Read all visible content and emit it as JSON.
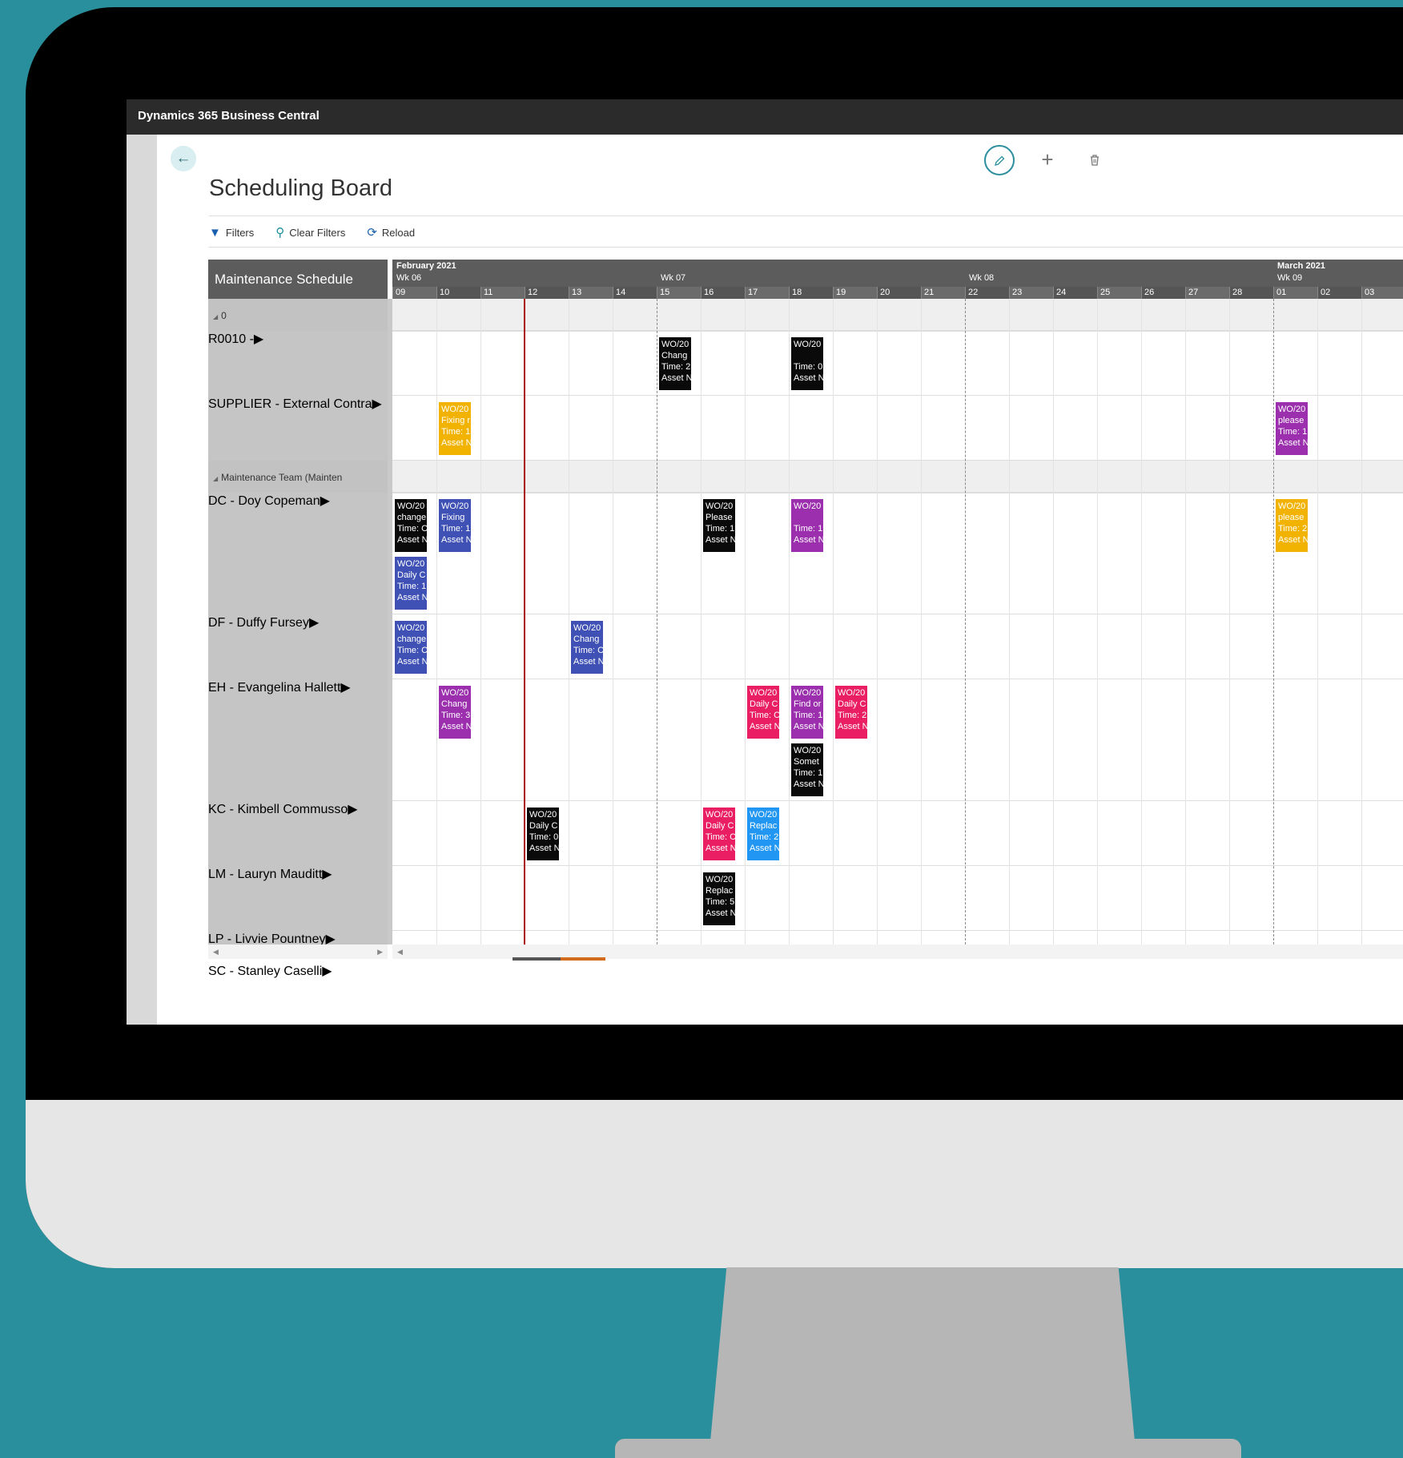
{
  "app": {
    "title": "Dynamics 365 Business Central"
  },
  "page": {
    "title": "Scheduling Board"
  },
  "toolbar": {
    "edit_icon": "pencil-icon",
    "add_icon": "plus-icon",
    "delete_icon": "trash-icon"
  },
  "actions": [
    {
      "label": "Filters",
      "icon": "filter-icon"
    },
    {
      "label": "Clear Filters",
      "icon": "clear-filter-icon"
    },
    {
      "label": "Reload",
      "icon": "refresh-icon"
    }
  ],
  "board": {
    "resource_header": "Maintenance Schedule",
    "months": [
      {
        "label": "February 2021",
        "start": 0
      },
      {
        "label": "March 2021",
        "start": 20
      }
    ],
    "weeks": [
      {
        "label": "Wk 06",
        "start": 0
      },
      {
        "label": "Wk 07",
        "start": 6
      },
      {
        "label": "Wk 08",
        "start": 13
      },
      {
        "label": "Wk 09",
        "start": 20
      }
    ],
    "days": [
      "09",
      "10",
      "11",
      "12",
      "13",
      "14",
      "15",
      "16",
      "17",
      "18",
      "19",
      "20",
      "21",
      "22",
      "23",
      "24",
      "25",
      "26",
      "27",
      "28",
      "01",
      "02",
      "03",
      "04"
    ],
    "today_index": 3,
    "colors": {
      "black": "#0a0a0a",
      "orange": "#f2b200",
      "purple": "#9b2fae",
      "blue": "#3f51b5",
      "pink": "#e91e63",
      "lightblue": "#2196f3"
    },
    "rows": [
      {
        "type": "group",
        "label": "0"
      },
      {
        "type": "resource",
        "label": "R0010 -"
      },
      {
        "type": "resource",
        "label": "SUPPLIER - External Contra"
      },
      {
        "type": "group",
        "label": "Maintenance Team (Mainten"
      },
      {
        "type": "resource",
        "label": "DC - Doy Copeman"
      },
      {
        "type": "resource",
        "label": "DF - Duffy Fursey"
      },
      {
        "type": "resource",
        "label": "EH - Evangelina Hallett"
      },
      {
        "type": "resource",
        "label": "KC - Kimbell Commusso"
      },
      {
        "type": "resource",
        "label": "LM - Lauryn Mauditt"
      },
      {
        "type": "resource",
        "label": "LP - Livvie Pountney"
      },
      {
        "type": "resource",
        "label": "SC - Stanley Caselli"
      }
    ],
    "work_orders": [
      {
        "row": 1,
        "day": 6,
        "slot": 0,
        "color": "black",
        "lines": [
          "WO/20",
          "Chang",
          "Time: 2",
          "Asset N"
        ]
      },
      {
        "row": 1,
        "day": 9,
        "slot": 0,
        "color": "black",
        "lines": [
          "WO/20",
          "",
          "Time: 0",
          "Asset N"
        ]
      },
      {
        "row": 2,
        "day": 1,
        "slot": 0,
        "color": "orange",
        "lines": [
          "WO/20",
          "Fixing r",
          "Time: 1",
          "Asset N"
        ]
      },
      {
        "row": 2,
        "day": 20,
        "slot": 0,
        "color": "purple",
        "lines": [
          "WO/20",
          "please",
          "Time: 1",
          "Asset N"
        ]
      },
      {
        "row": 4,
        "day": 0,
        "slot": 0,
        "color": "black",
        "lines": [
          "WO/20",
          "change",
          "Time: C",
          "Asset N"
        ]
      },
      {
        "row": 4,
        "day": 0,
        "slot": 1,
        "color": "blue",
        "lines": [
          "WO/20",
          "Daily C",
          "Time: 1",
          "Asset N"
        ]
      },
      {
        "row": 4,
        "day": 1,
        "slot": 0,
        "color": "blue",
        "lines": [
          "WO/20",
          "Fixing",
          "Time: 1",
          "Asset N"
        ]
      },
      {
        "row": 4,
        "day": 7,
        "slot": 0,
        "color": "black",
        "lines": [
          "WO/20",
          "Please",
          "Time: 1",
          "Asset N"
        ]
      },
      {
        "row": 4,
        "day": 9,
        "slot": 0,
        "color": "purple",
        "lines": [
          "WO/20",
          "",
          "Time: 1",
          "Asset N"
        ]
      },
      {
        "row": 4,
        "day": 20,
        "slot": 0,
        "color": "orange",
        "lines": [
          "WO/20",
          "please",
          "Time: 2",
          "Asset N"
        ]
      },
      {
        "row": 5,
        "day": 0,
        "slot": 0,
        "color": "blue",
        "lines": [
          "WO/20",
          "change",
          "Time: C",
          "Asset N"
        ]
      },
      {
        "row": 5,
        "day": 4,
        "slot": 0,
        "color": "blue",
        "lines": [
          "WO/20",
          "Chang",
          "Time: C",
          "Asset N"
        ]
      },
      {
        "row": 6,
        "day": 1,
        "slot": 0,
        "color": "purple",
        "lines": [
          "WO/20",
          "Chang",
          "Time: 3",
          "Asset N"
        ]
      },
      {
        "row": 6,
        "day": 8,
        "slot": 0,
        "color": "pink",
        "lines": [
          "WO/20",
          "Daily C",
          "Time: C",
          "Asset N"
        ]
      },
      {
        "row": 6,
        "day": 9,
        "slot": 0,
        "color": "purple",
        "lines": [
          "WO/20",
          "Find or",
          "Time: 1",
          "Asset N"
        ]
      },
      {
        "row": 6,
        "day": 9,
        "slot": 1,
        "color": "black",
        "lines": [
          "WO/20",
          "Somet",
          "Time: 1",
          "Asset N"
        ]
      },
      {
        "row": 6,
        "day": 10,
        "slot": 0,
        "color": "pink",
        "lines": [
          "WO/20",
          "Daily C",
          "Time: 2",
          "Asset N"
        ]
      },
      {
        "row": 7,
        "day": 3,
        "slot": 0,
        "color": "black",
        "lines": [
          "WO/20",
          "Daily C",
          "Time: 0",
          "Asset N"
        ]
      },
      {
        "row": 7,
        "day": 7,
        "slot": 0,
        "color": "pink",
        "lines": [
          "WO/20",
          "Daily C",
          "Time: C",
          "Asset N"
        ]
      },
      {
        "row": 7,
        "day": 8,
        "slot": 0,
        "color": "lightblue",
        "lines": [
          "WO/20",
          "Replac",
          "Time: 2",
          "Asset N"
        ]
      },
      {
        "row": 8,
        "day": 7,
        "slot": 0,
        "color": "black",
        "lines": [
          "WO/20",
          "Replac",
          "Time: 5",
          "Asset N"
        ]
      }
    ]
  }
}
